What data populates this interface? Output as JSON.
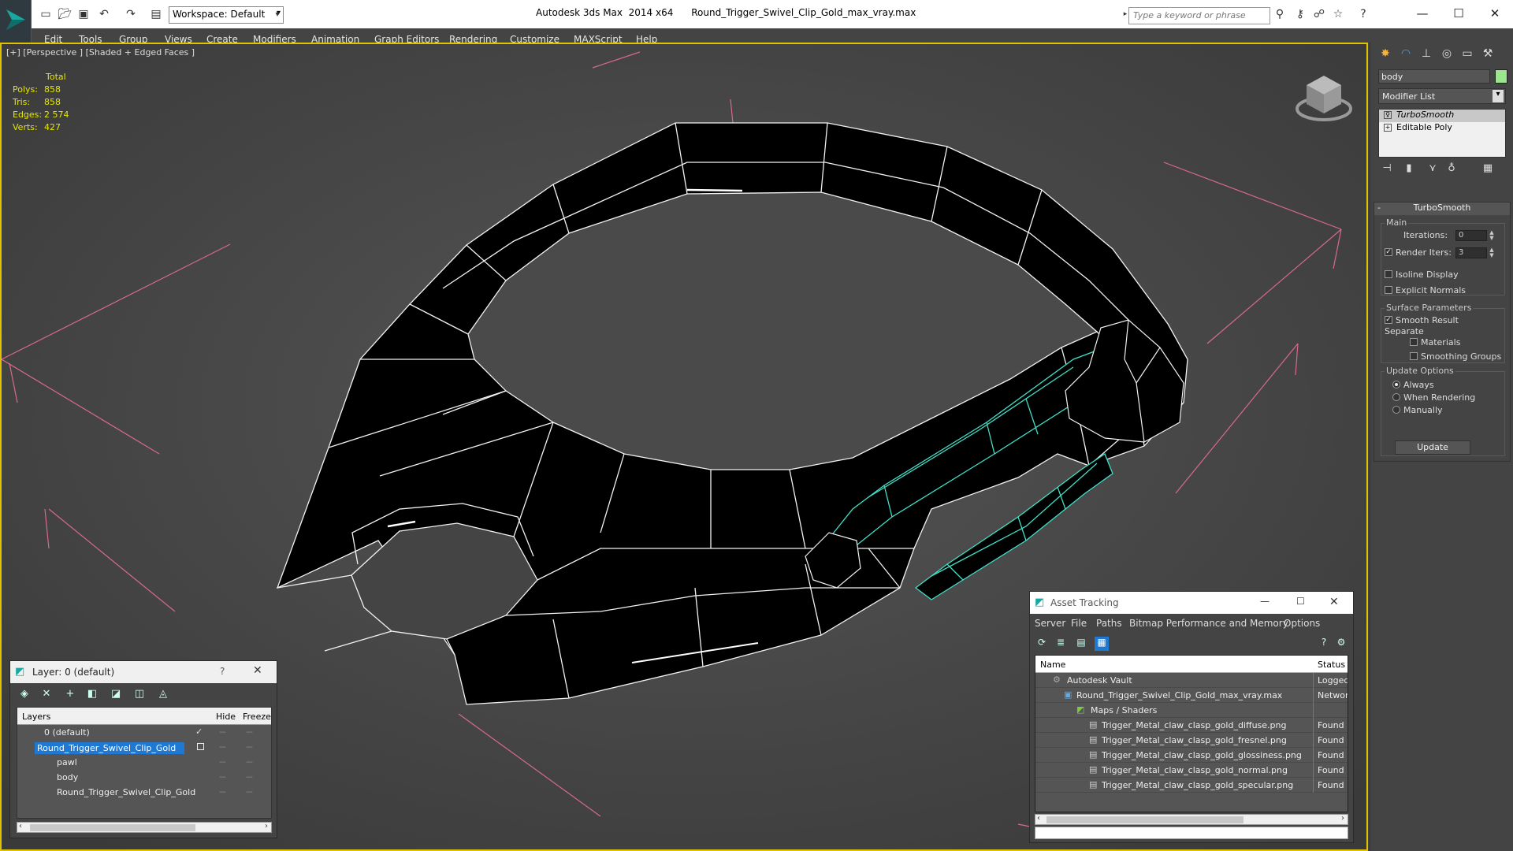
{
  "window": {
    "title": "Autodesk 3ds Max  2014 x64      Round_Trigger_Swivel_Clip_Gold_max_vray.max",
    "workspace": "Workspace: Default",
    "search_placeholder": "Type a keyword or phrase"
  },
  "menu": [
    "Edit",
    "Tools",
    "Group",
    "Views",
    "Create",
    "Modifiers",
    "Animation",
    "Graph Editors",
    "Rendering",
    "Customize",
    "MAXScript",
    "Help"
  ],
  "viewport": {
    "label": "[+] [Perspective ] [Shaded + Edged Faces ]",
    "stats": {
      "total_label": "Total",
      "rows": [
        {
          "label": "Polys:",
          "value": "858"
        },
        {
          "label": "Tris:",
          "value": "858"
        },
        {
          "label": "Edges:",
          "value": "2 574"
        },
        {
          "label": "Verts:",
          "value": "427"
        }
      ]
    }
  },
  "command_panel": {
    "object_name": "body",
    "modifier_list": "Modifier List",
    "stack": [
      "TurboSmooth",
      "Editable Poly"
    ],
    "rollout_title": "TurboSmooth",
    "main_group": "Main",
    "iterations_label": "Iterations:",
    "iterations_value": "0",
    "render_iters_label": "Render Iters:",
    "render_iters_value": "3",
    "isoline_display": "Isoline Display",
    "explicit_normals": "Explicit Normals",
    "surface_group": "Surface Parameters",
    "smooth_result": "Smooth Result",
    "separate_label": "Separate",
    "materials": "Materials",
    "smoothing_groups": "Smoothing Groups",
    "update_group": "Update Options",
    "always": "Always",
    "when_rendering": "When Rendering",
    "manually": "Manually",
    "update_button": "Update"
  },
  "layer_panel": {
    "title": "Layer: 0 (default)",
    "help": "?",
    "columns": {
      "layers": "Layers",
      "hide": "Hide",
      "freeze": "Freeze"
    },
    "rows": [
      {
        "name": "0 (default)"
      },
      {
        "name": "Round_Trigger_Swivel_Clip_Gold"
      },
      {
        "name": "pawl"
      },
      {
        "name": "body"
      },
      {
        "name": "Round_Trigger_Swivel_Clip_Gold"
      }
    ]
  },
  "asset_panel": {
    "title": "Asset Tracking",
    "menu": [
      "Server",
      "File",
      "Paths",
      "Bitmap Performance and Memory",
      "Options"
    ],
    "columns": {
      "name": "Name",
      "status": "Status"
    },
    "rows": [
      {
        "name": "Autodesk Vault",
        "status": "Logged O"
      },
      {
        "name": "Round_Trigger_Swivel_Clip_Gold_max_vray.max",
        "status": "Network"
      },
      {
        "name": "Maps / Shaders",
        "status": ""
      },
      {
        "name": "Trigger_Metal_claw_clasp_gold_diffuse.png",
        "status": "Found"
      },
      {
        "name": "Trigger_Metal_claw_clasp_gold_fresnel.png",
        "status": "Found"
      },
      {
        "name": "Trigger_Metal_claw_clasp_gold_glossiness.png",
        "status": "Found"
      },
      {
        "name": "Trigger_Metal_claw_clasp_gold_normal.png",
        "status": "Found"
      },
      {
        "name": "Trigger_Metal_claw_clasp_gold_specular.png",
        "status": "Found"
      }
    ]
  },
  "colors": {
    "viewport_border": "#e0c200",
    "stats_text": "#e6e600",
    "selection": "#1f78d1",
    "object_color": "#9be68f",
    "wire_selected": "#40e0c8"
  }
}
